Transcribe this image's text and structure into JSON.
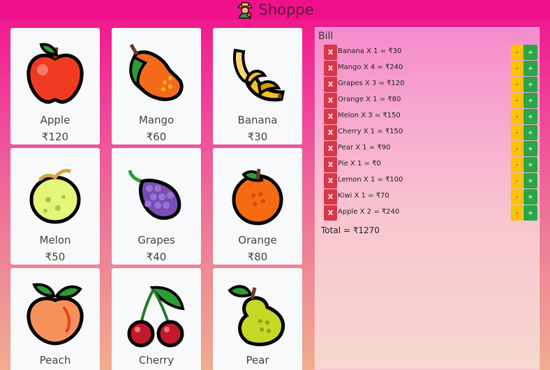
{
  "header": {
    "title": "Shoppe",
    "icon": "farmer-icon"
  },
  "products": [
    {
      "name": "Apple",
      "price": "₹120",
      "icon": "apple-icon"
    },
    {
      "name": "Mango",
      "price": "₹60",
      "icon": "mango-icon"
    },
    {
      "name": "Banana",
      "price": "₹30",
      "icon": "banana-icon"
    },
    {
      "name": "Melon",
      "price": "₹50",
      "icon": "melon-icon"
    },
    {
      "name": "Grapes",
      "price": "₹40",
      "icon": "grapes-icon"
    },
    {
      "name": "Orange",
      "price": "₹80",
      "icon": "orange-icon"
    },
    {
      "name": "Peach",
      "price": "",
      "icon": "peach-icon"
    },
    {
      "name": "Cherry",
      "price": "",
      "icon": "cherry-icon"
    },
    {
      "name": "Pear",
      "price": "",
      "icon": "pear-icon"
    }
  ],
  "bill": {
    "title": "Bill",
    "remove_label": "X",
    "decrement_label": "-",
    "increment_label": "+",
    "items": [
      {
        "text": "Banana X 1 = ₹30"
      },
      {
        "text": "Mango X 4 = ₹240"
      },
      {
        "text": "Grapes X 3 = ₹120"
      },
      {
        "text": "Orange X 1 = ₹80"
      },
      {
        "text": "Melon X 3 = ₹150"
      },
      {
        "text": "Cherry X 1 = ₹150"
      },
      {
        "text": "Pear X 1 = ₹90"
      },
      {
        "text": "Pie X 1 = ₹0"
      },
      {
        "text": "Lemon X 1 = ₹100"
      },
      {
        "text": "Kiwi X 1 = ₹70"
      },
      {
        "text": "Apple X 2 = ₹240"
      }
    ],
    "total": "Total = ₹1270"
  },
  "colors": {
    "header": "#f0108c",
    "remove": "#dc3545",
    "decrement": "#ffc107",
    "increment": "#28a745",
    "card": "#f8f9fa"
  }
}
